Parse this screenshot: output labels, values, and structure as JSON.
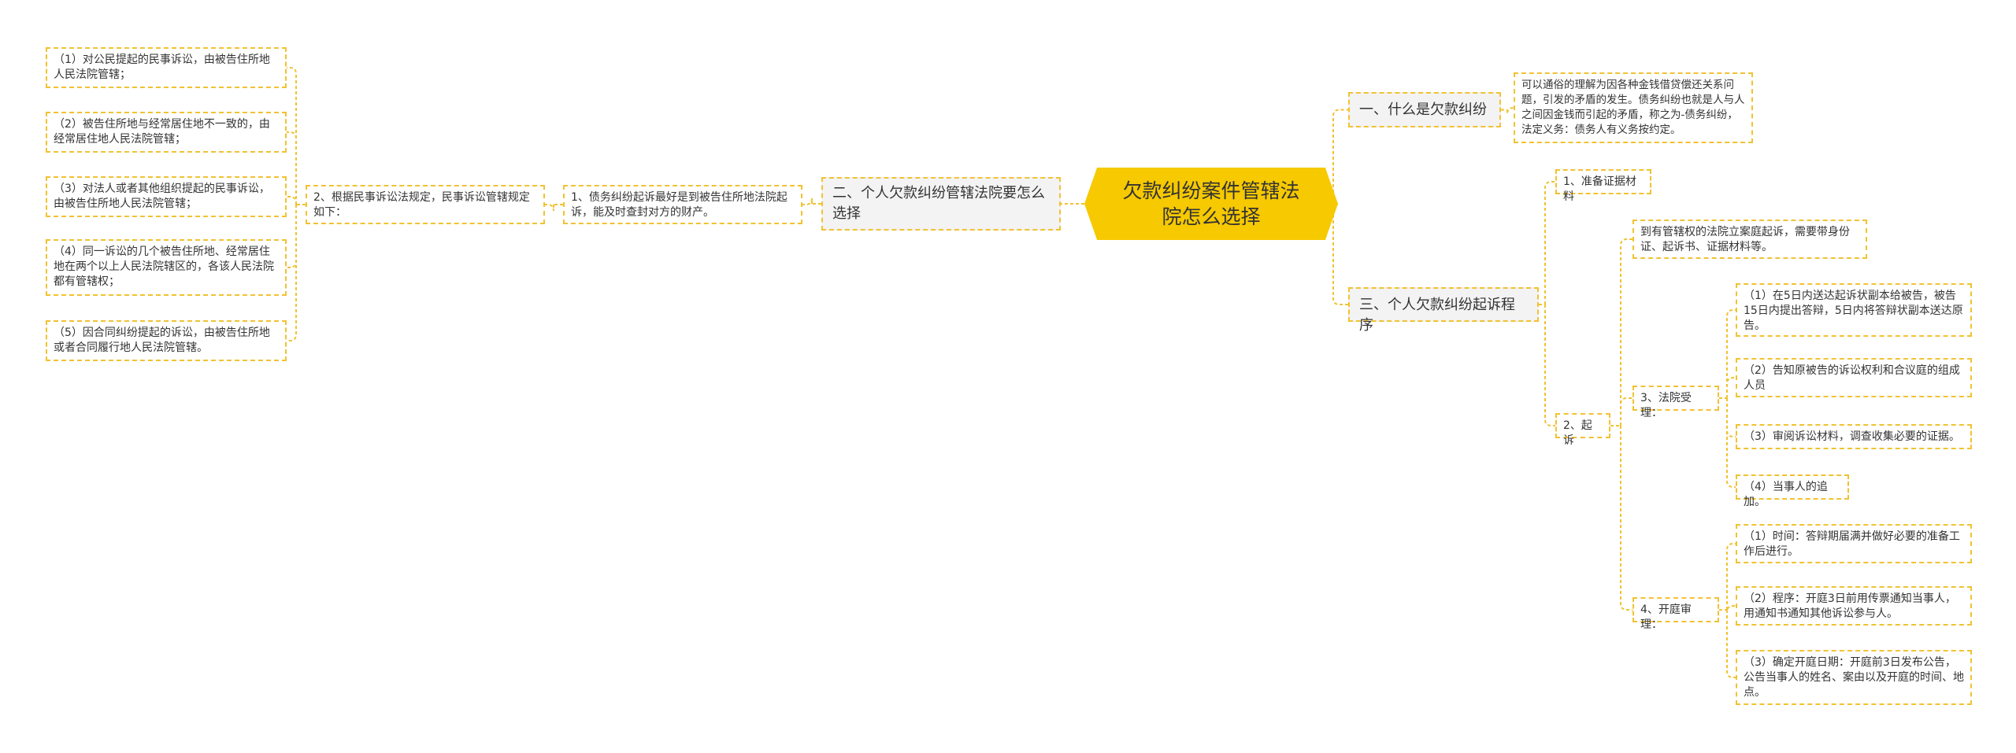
{
  "root": {
    "title": "欠款纠纷案件管辖法院怎么选择"
  },
  "right": {
    "branch1": {
      "label": "一、什么是欠款纠纷",
      "desc": "可以通俗的理解为因各种金钱借贷偿还关系问题，引发的矛盾的发生。债务纠纷也就是人与人之间因金钱而引起的矛盾，称之为-债务纠纷，法定义务：债务人有义务按约定。"
    },
    "branch3": {
      "label": "三、个人欠款纠纷起诉程序",
      "step1": "1、准备证据材料",
      "step2": "2、起诉",
      "step2_desc": "到有管辖权的法院立案庭起诉，需要带身份证、起诉书、证据材料等。",
      "step3": "3、法院受理：",
      "step3_items": [
        "（1）在5日内送达起诉状副本给被告，被告15日内提出答辩，5日内将答辩状副本送达原告。",
        "（2）告知原被告的诉讼权利和合议庭的组成人员",
        "（3）审阅诉讼材料，调查收集必要的证据。",
        "（4）当事人的追加。"
      ],
      "step4": "4、开庭审理：",
      "step4_items": [
        "（1）时间：答辩期届满并做好必要的准备工作后进行。",
        "（2）程序：开庭3日前用传票通知当事人，用通知书通知其他诉讼参与人。",
        "（3）确定开庭日期：开庭前3日发布公告，公告当事人的姓名、案由以及开庭的时间、地点。"
      ]
    }
  },
  "left": {
    "branch2": {
      "label": "二、个人欠款纠纷管辖法院要怎么选择",
      "item1": "1、债务纠纷起诉最好是到被告住所地法院起诉，能及时查封对方的财产。",
      "item2": "2、根据民事诉讼法规定，民事诉讼管辖规定如下：",
      "rules": [
        "（1）对公民提起的民事诉讼，由被告住所地人民法院管辖；",
        "（2）被告住所地与经常居住地不一致的，由经常居住地人民法院管辖；",
        "（3）对法人或者其他组织提起的民事诉讼，由被告住所地人民法院管辖；",
        "（4）同一诉讼的几个被告住所地、经常居住地在两个以上人民法院辖区的，各该人民法院都有管辖权；",
        "（5）因合同纠纷提起的诉讼，由被告住所地或者合同履行地人民法院管辖。"
      ]
    }
  },
  "colors": {
    "root_fill": "#f6c900",
    "line": "#f1c232",
    "branch_fill": "#f3f3f3"
  }
}
